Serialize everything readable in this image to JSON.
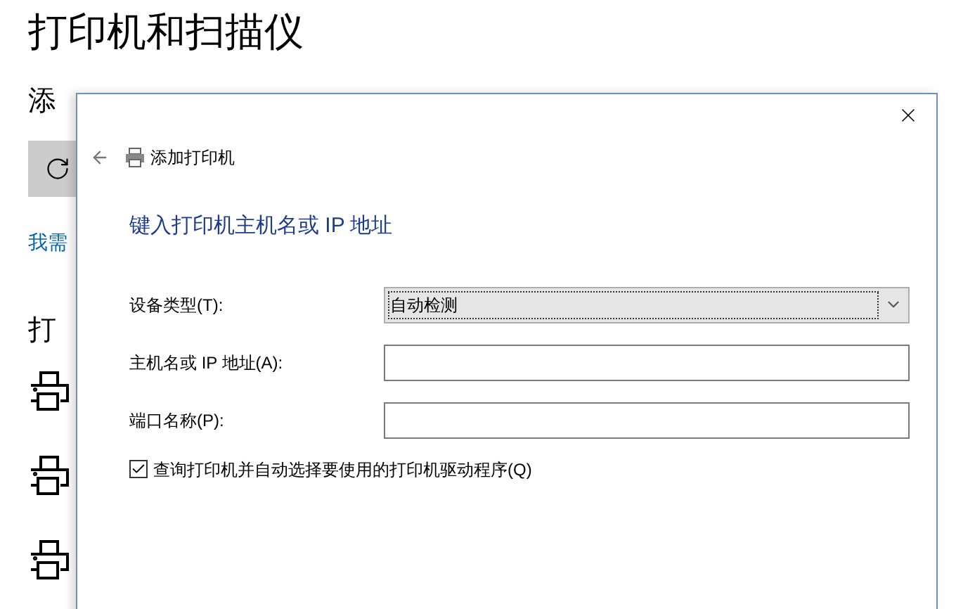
{
  "settings": {
    "title": "打印机和扫描仪",
    "section_title": "添",
    "help_link": "我需",
    "list_heading": "打"
  },
  "dialog": {
    "title": "添加打印机",
    "heading": "键入打印机主机名或 IP 地址",
    "fields": [
      {
        "kind": "select",
        "label": "设备类型(T):",
        "value": "自动检测"
      },
      {
        "kind": "text",
        "label": "主机名或 IP 地址(A):"
      },
      {
        "kind": "text",
        "label": "端口名称(P):"
      }
    ],
    "checkbox": {
      "label": "查询打印机并自动选择要使用的打印机驱动程序(Q)",
      "checked": true
    }
  }
}
